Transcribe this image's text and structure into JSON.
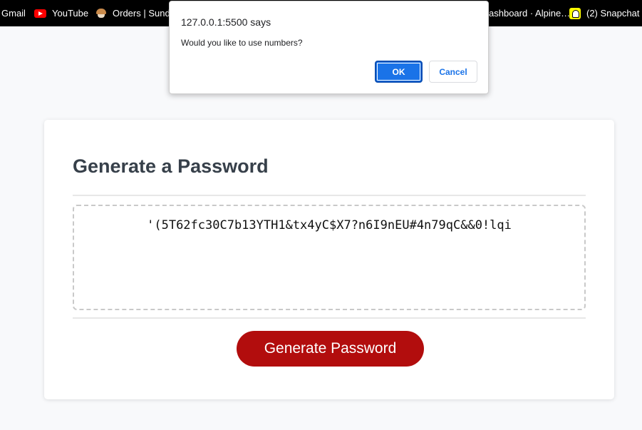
{
  "bookmarks_bar": {
    "items": [
      {
        "label": "Gmail",
        "icon": "gmail-icon"
      },
      {
        "label": "YouTube",
        "icon": "youtube-icon"
      },
      {
        "label": "Orders | Sunda",
        "icon": "sundae-icon"
      },
      {
        "label": "ashboard · Alpine…",
        "icon": null
      },
      {
        "label": "(2) Snapchat",
        "icon": "snapchat-icon"
      }
    ]
  },
  "card": {
    "title": "Generate a Password",
    "password": "'(5T62fc30C7b13YTH1&tx4yC$X7?n6I9nEU#4n79qC&&0!lqi",
    "generate_button_label": "Generate Password"
  },
  "dialog": {
    "origin": "127.0.0.1:5500 says",
    "message": "Would you like to use numbers?",
    "ok_label": "OK",
    "cancel_label": "Cancel"
  },
  "colors": {
    "accent_button": "#b20d0d",
    "dialog_primary": "#1a73e8",
    "page_background": "#f8f9fb"
  }
}
